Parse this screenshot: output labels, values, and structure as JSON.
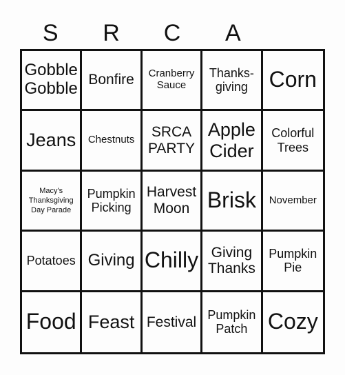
{
  "header": {
    "letters": [
      "S",
      "R",
      "C",
      "A",
      ""
    ]
  },
  "board": {
    "rows": [
      [
        {
          "text": "Gobble\nGobble",
          "size": "ml"
        },
        {
          "text": "Bonfire",
          "size": "md"
        },
        {
          "text": "Cranberry\nSauce",
          "size": "xs"
        },
        {
          "text": "Thanks-\ngiving",
          "size": "sm"
        },
        {
          "text": "Corn",
          "size": "xl"
        }
      ],
      [
        {
          "text": "Jeans",
          "size": "lg"
        },
        {
          "text": "Chestnuts",
          "size": "xs"
        },
        {
          "text": "SRCA\nPARTY",
          "size": "md"
        },
        {
          "text": "Apple\nCider",
          "size": "lg"
        },
        {
          "text": "Colorful\nTrees",
          "size": "sm"
        }
      ],
      [
        {
          "text": "Macy's\nThanksgiving\nDay Parade",
          "size": "xxs"
        },
        {
          "text": "Pumpkin\nPicking",
          "size": "sm"
        },
        {
          "text": "Harvest\nMoon",
          "size": "md"
        },
        {
          "text": "Brisk",
          "size": "xl"
        },
        {
          "text": "November",
          "size": "xs"
        }
      ],
      [
        {
          "text": "Potatoes",
          "size": "sm"
        },
        {
          "text": "Giving",
          "size": "ml"
        },
        {
          "text": "Chilly",
          "size": "xl"
        },
        {
          "text": "Giving\nThanks",
          "size": "md"
        },
        {
          "text": "Pumpkin\nPie",
          "size": "sm"
        }
      ],
      [
        {
          "text": "Food",
          "size": "xl"
        },
        {
          "text": "Feast",
          "size": "lg"
        },
        {
          "text": "Festival",
          "size": "md"
        },
        {
          "text": "Pumpkin\nPatch",
          "size": "sm"
        },
        {
          "text": "Cozy",
          "size": "xl"
        }
      ]
    ]
  }
}
